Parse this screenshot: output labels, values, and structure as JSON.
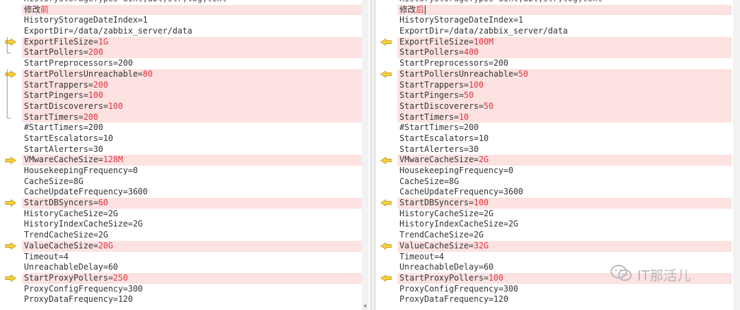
{
  "left": {
    "lines": [
      {
        "segments": [
          {
            "text": "HistoryStorageTypes=uint,dbl,str,log,text",
            "diff": false
          }
        ],
        "changed": false,
        "clipped": true
      },
      {
        "segments": [
          {
            "text": "修改",
            "diff": false,
            "cjk": true
          },
          {
            "text": "前",
            "diff": true,
            "cjk": true
          }
        ],
        "changed": true
      },
      {
        "segments": [
          {
            "text": "HistoryStorageDateIndex=1",
            "diff": false
          }
        ],
        "changed": false
      },
      {
        "segments": [
          {
            "text": "ExportDir=/data/zabbix_server/data",
            "diff": false
          }
        ],
        "changed": false
      },
      {
        "segments": [
          {
            "text": "ExportFileSize=",
            "diff": false
          },
          {
            "text": "1G",
            "diff": true
          }
        ],
        "changed": true,
        "marker": "arrow-right",
        "bracket": "start"
      },
      {
        "segments": [
          {
            "text": "StartPollers=",
            "diff": false
          },
          {
            "text": "200",
            "diff": true
          }
        ],
        "changed": true,
        "bracket": "end"
      },
      {
        "segments": [
          {
            "text": "StartPreprocessors=200",
            "diff": false
          }
        ],
        "changed": false
      },
      {
        "segments": [
          {
            "text": "StartPollersUnreachable=",
            "diff": false
          },
          {
            "text": "80",
            "diff": true
          }
        ],
        "changed": true,
        "marker": "arrow-right",
        "bracket": "start"
      },
      {
        "segments": [
          {
            "text": "StartTrappers=",
            "diff": false
          },
          {
            "text": "200",
            "diff": true
          }
        ],
        "changed": true,
        "bracket": "mid"
      },
      {
        "segments": [
          {
            "text": "StartPingers=",
            "diff": false
          },
          {
            "text": "100",
            "diff": true
          }
        ],
        "changed": true,
        "bracket": "mid"
      },
      {
        "segments": [
          {
            "text": "StartDiscoverers=",
            "diff": false
          },
          {
            "text": "100",
            "diff": true
          }
        ],
        "changed": true,
        "bracket": "mid"
      },
      {
        "segments": [
          {
            "text": "StartTimers=",
            "diff": false
          },
          {
            "text": "200",
            "diff": true
          }
        ],
        "changed": true,
        "bracket": "end"
      },
      {
        "segments": [
          {
            "text": "#StartTimers=200",
            "diff": false
          }
        ],
        "changed": false
      },
      {
        "segments": [
          {
            "text": "StartEscalators=10",
            "diff": false
          }
        ],
        "changed": false
      },
      {
        "segments": [
          {
            "text": "StartAlerters=30",
            "diff": false
          }
        ],
        "changed": false
      },
      {
        "segments": [
          {
            "text": "VMwareCacheSize=",
            "diff": false
          },
          {
            "text": "128M",
            "diff": true
          }
        ],
        "changed": true,
        "marker": "arrow-right"
      },
      {
        "segments": [
          {
            "text": "HousekeepingFrequency=0",
            "diff": false
          }
        ],
        "changed": false
      },
      {
        "segments": [
          {
            "text": "CacheSize=8G",
            "diff": false
          }
        ],
        "changed": false
      },
      {
        "segments": [
          {
            "text": "CacheUpdateFrequency=3600",
            "diff": false
          }
        ],
        "changed": false
      },
      {
        "segments": [
          {
            "text": "StartDBSyncers=",
            "diff": false
          },
          {
            "text": "60",
            "diff": true
          }
        ],
        "changed": true,
        "marker": "arrow-right"
      },
      {
        "segments": [
          {
            "text": "HistoryCacheSize=2G",
            "diff": false
          }
        ],
        "changed": false
      },
      {
        "segments": [
          {
            "text": "HistoryIndexCacheSize=2G",
            "diff": false
          }
        ],
        "changed": false
      },
      {
        "segments": [
          {
            "text": "TrendCacheSize=2G",
            "diff": false
          }
        ],
        "changed": false
      },
      {
        "segments": [
          {
            "text": "ValueCacheSize=",
            "diff": false
          },
          {
            "text": "20G",
            "diff": true
          }
        ],
        "changed": true,
        "marker": "arrow-right"
      },
      {
        "segments": [
          {
            "text": "Timeout=4",
            "diff": false
          }
        ],
        "changed": false
      },
      {
        "segments": [
          {
            "text": "UnreachableDelay=60",
            "diff": false
          }
        ],
        "changed": false
      },
      {
        "segments": [
          {
            "text": "StartProxyPollers=",
            "diff": false
          },
          {
            "text": "250",
            "diff": true
          }
        ],
        "changed": true,
        "marker": "arrow-right"
      },
      {
        "segments": [
          {
            "text": "ProxyConfigFrequency=300",
            "diff": false
          }
        ],
        "changed": false
      },
      {
        "segments": [
          {
            "text": "ProxyDataFrequency=120",
            "diff": false
          }
        ],
        "changed": false
      }
    ]
  },
  "right": {
    "lines": [
      {
        "segments": [
          {
            "text": "HistoryStorageTypes=uint,dbl,str,log,text",
            "diff": false
          }
        ],
        "changed": false,
        "clipped": true
      },
      {
        "segments": [
          {
            "text": "修改",
            "diff": false,
            "cjk": true
          },
          {
            "text": "后",
            "diff": true,
            "cjk": true
          }
        ],
        "changed": true,
        "caret": true
      },
      {
        "segments": [
          {
            "text": "HistoryStorageDateIndex=1",
            "diff": false
          }
        ],
        "changed": false
      },
      {
        "segments": [
          {
            "text": "ExportDir=/data/zabbix_server/data",
            "diff": false
          }
        ],
        "changed": false
      },
      {
        "segments": [
          {
            "text": "ExportFileSize=",
            "diff": false
          },
          {
            "text": "100M",
            "diff": true
          }
        ],
        "changed": true,
        "marker": "arrow-left"
      },
      {
        "segments": [
          {
            "text": "StartPollers=",
            "diff": false
          },
          {
            "text": "400",
            "diff": true
          }
        ],
        "changed": true
      },
      {
        "segments": [
          {
            "text": "StartPreprocessors=200",
            "diff": false
          }
        ],
        "changed": false
      },
      {
        "segments": [
          {
            "text": "StartPollersUnreachable=",
            "diff": false
          },
          {
            "text": "50",
            "diff": true
          }
        ],
        "changed": true,
        "marker": "arrow-left"
      },
      {
        "segments": [
          {
            "text": "StartTrappers=",
            "diff": false
          },
          {
            "text": "100",
            "diff": true
          }
        ],
        "changed": true
      },
      {
        "segments": [
          {
            "text": "StartPingers=",
            "diff": false
          },
          {
            "text": "50",
            "diff": true
          }
        ],
        "changed": true
      },
      {
        "segments": [
          {
            "text": "StartDiscoverers=",
            "diff": false
          },
          {
            "text": "50",
            "diff": true
          }
        ],
        "changed": true
      },
      {
        "segments": [
          {
            "text": "StartTimers=",
            "diff": false
          },
          {
            "text": "10",
            "diff": true
          }
        ],
        "changed": true
      },
      {
        "segments": [
          {
            "text": "#StartTimers=200",
            "diff": false
          }
        ],
        "changed": false
      },
      {
        "segments": [
          {
            "text": "StartEscalators=10",
            "diff": false
          }
        ],
        "changed": false
      },
      {
        "segments": [
          {
            "text": "StartAlerters=30",
            "diff": false
          }
        ],
        "changed": false
      },
      {
        "segments": [
          {
            "text": "VMwareCacheSize=",
            "diff": false
          },
          {
            "text": "2G",
            "diff": true
          }
        ],
        "changed": true,
        "marker": "arrow-left"
      },
      {
        "segments": [
          {
            "text": "HousekeepingFrequency=0",
            "diff": false
          }
        ],
        "changed": false
      },
      {
        "segments": [
          {
            "text": "CacheSize=8G",
            "diff": false
          }
        ],
        "changed": false
      },
      {
        "segments": [
          {
            "text": "CacheUpdateFrequency=3600",
            "diff": false
          }
        ],
        "changed": false
      },
      {
        "segments": [
          {
            "text": "StartDBSyncers=",
            "diff": false
          },
          {
            "text": "100",
            "diff": true
          }
        ],
        "changed": true,
        "marker": "arrow-left"
      },
      {
        "segments": [
          {
            "text": "HistoryCacheSize=2G",
            "diff": false
          }
        ],
        "changed": false
      },
      {
        "segments": [
          {
            "text": "HistoryIndexCacheSize=2G",
            "diff": false
          }
        ],
        "changed": false
      },
      {
        "segments": [
          {
            "text": "TrendCacheSize=2G",
            "diff": false
          }
        ],
        "changed": false
      },
      {
        "segments": [
          {
            "text": "ValueCacheSize=",
            "diff": false
          },
          {
            "text": "32G",
            "diff": true
          }
        ],
        "changed": true,
        "marker": "arrow-left"
      },
      {
        "segments": [
          {
            "text": "Timeout=4",
            "diff": false
          }
        ],
        "changed": false
      },
      {
        "segments": [
          {
            "text": "UnreachableDelay=60",
            "diff": false
          }
        ],
        "changed": false
      },
      {
        "segments": [
          {
            "text": "StartProxyPollers=",
            "diff": false
          },
          {
            "text": "100",
            "diff": true
          }
        ],
        "changed": true,
        "marker": "arrow-left"
      },
      {
        "segments": [
          {
            "text": "ProxyConfigFrequency=300",
            "diff": false
          }
        ],
        "changed": false
      },
      {
        "segments": [
          {
            "text": "ProxyDataFrequency=120",
            "diff": false
          }
        ],
        "changed": false
      }
    ]
  },
  "watermark": {
    "text": "IT那活儿",
    "icon": "wechat-icon"
  },
  "colors": {
    "changed_bg": "#fde2e2",
    "diff_text": "#e0303a",
    "arrow_fill": "#f6d23c",
    "arrow_stroke": "#c99a14",
    "normal_text": "#333333"
  },
  "icons": {
    "left_marker": "arrow-right-icon",
    "right_marker": "arrow-left-icon",
    "scroll_down": "scroll-down-arrow-icon"
  }
}
